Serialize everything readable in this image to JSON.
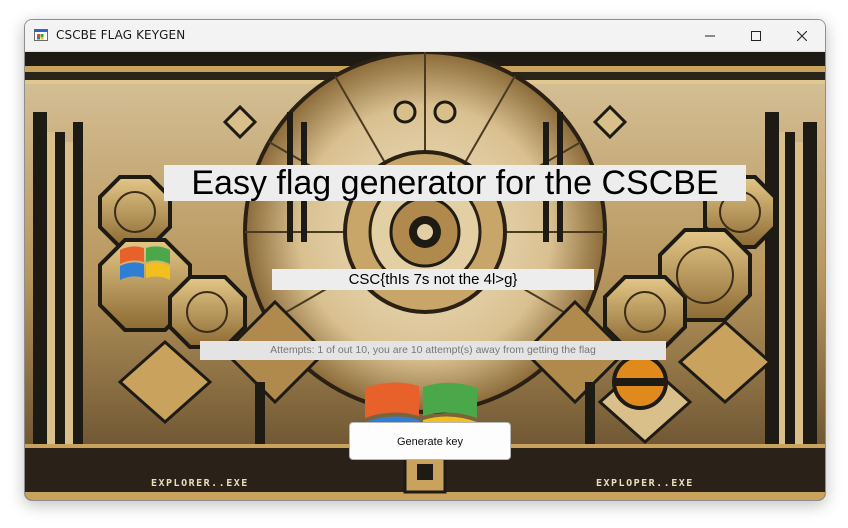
{
  "window": {
    "title": "CSCBE FLAG KEYGEN",
    "controls": {
      "minimize_icon": "minimize-icon",
      "maximize_icon": "maximize-icon",
      "close_icon": "close-icon"
    }
  },
  "main": {
    "heading": "Easy flag generator for the CSCBE",
    "flag_value": "CSC{thIs 7s not the 4l>g}",
    "attempts_text": "Attempts: 1 of out 10, you are 10 attempt(s) away from getting the flag",
    "generate_button_label": "Generate key",
    "background": {
      "footer_left": "EXPLORER..EXE",
      "footer_right": "EXPLOPER..EXE"
    }
  },
  "colors": {
    "titlebar": "#f3f3f3",
    "label_background": "#ededed",
    "art_gold": "#c9a25e",
    "art_dark": "#1e1a14",
    "art_cream": "#e8d9b8"
  }
}
